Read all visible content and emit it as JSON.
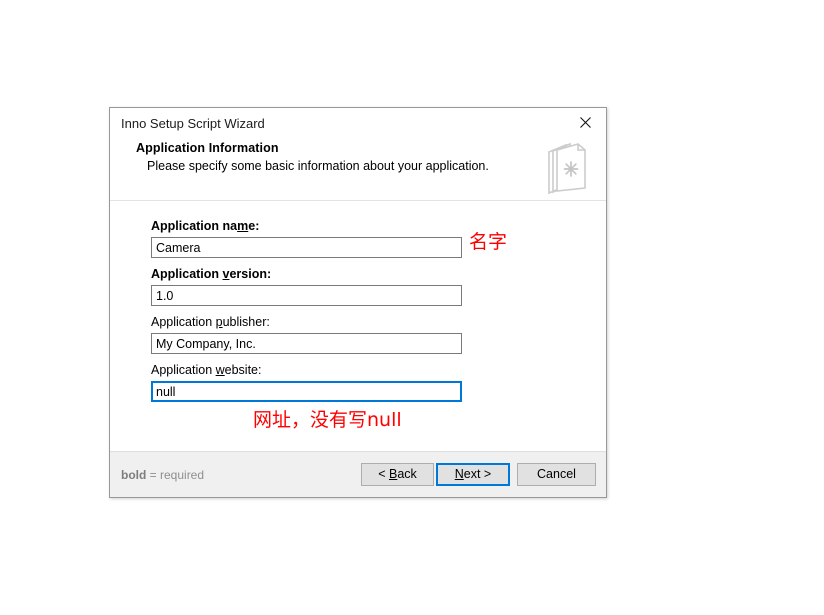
{
  "window": {
    "title": "Inno Setup Script Wizard",
    "close_icon": "close-icon"
  },
  "header": {
    "title": "Application Information",
    "subtitle": "Please specify some basic information about your application.",
    "icon": "book-asterisk-icon"
  },
  "form": {
    "fields": [
      {
        "label_prefix": "Application na",
        "label_mnemonic": "m",
        "label_suffix": "e:",
        "required": true,
        "value": "Camera",
        "placeholder": "",
        "focused": false
      },
      {
        "label_prefix": "Application ",
        "label_mnemonic": "v",
        "label_suffix": "ersion:",
        "required": true,
        "value": "1.0",
        "placeholder": "",
        "focused": false
      },
      {
        "label_prefix": "Application ",
        "label_mnemonic": "p",
        "label_suffix": "ublisher:",
        "required": false,
        "value": "My Company, Inc.",
        "placeholder": "",
        "focused": false
      },
      {
        "label_prefix": "Application ",
        "label_mnemonic": "w",
        "label_suffix": "ebsite:",
        "required": false,
        "value": "null",
        "placeholder": "",
        "focused": true
      }
    ]
  },
  "footer": {
    "note_bold": "bold",
    "note_rest": " = required",
    "buttons": {
      "back": {
        "prefix": "< ",
        "mnemonic": "B",
        "suffix": "ack"
      },
      "next": {
        "prefix": "",
        "mnemonic": "N",
        "suffix": "ext >",
        "default": true
      },
      "cancel": {
        "prefix": "Cancel",
        "mnemonic": "",
        "suffix": ""
      }
    }
  },
  "annotations": {
    "name_note": "名字",
    "website_note": "网址，没有写null",
    "color": "#ff0000"
  }
}
